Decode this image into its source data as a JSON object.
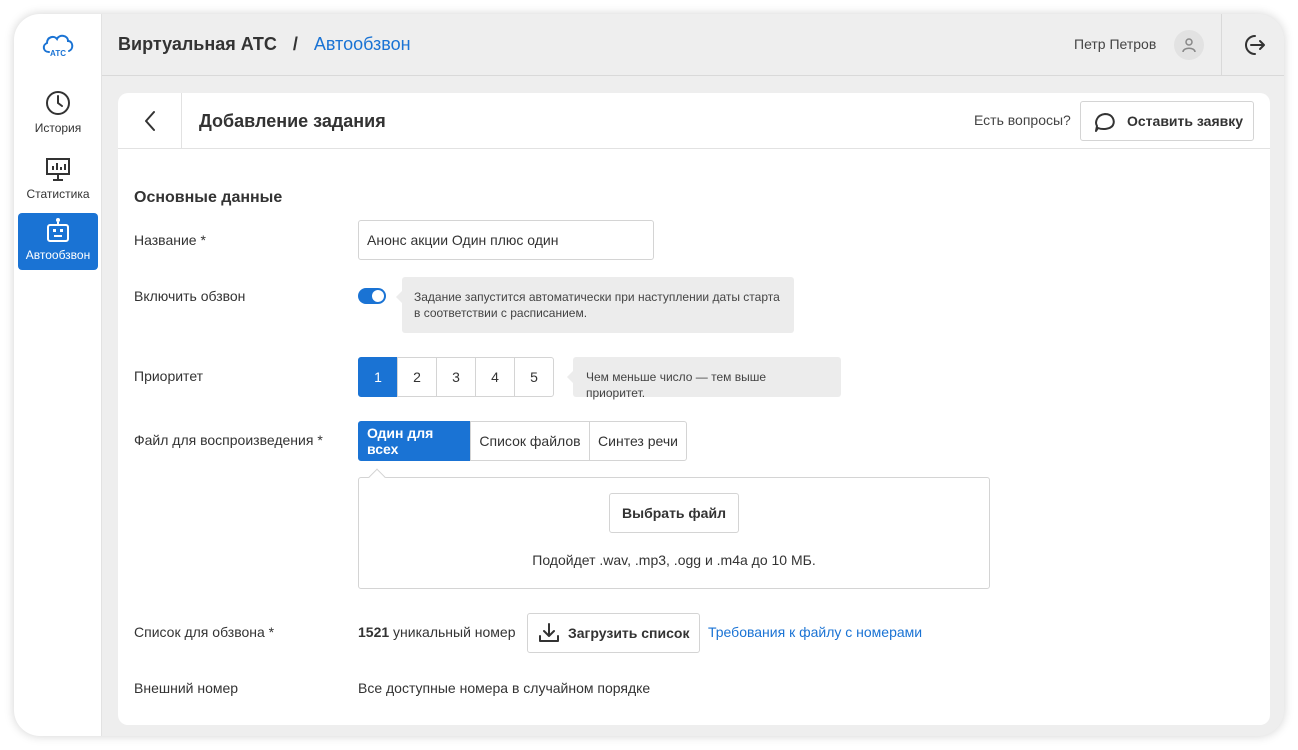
{
  "sidebar": {
    "logo_text": "АТС",
    "items": [
      {
        "label": "История",
        "icon": "clock-icon",
        "active": false
      },
      {
        "label": "Статистика",
        "icon": "chart-monitor-icon",
        "active": false
      },
      {
        "label": "Автообзвон",
        "icon": "robot-icon",
        "active": true
      }
    ]
  },
  "header": {
    "breadcrumb_root": "Виртуальная АТС",
    "breadcrumb_separator": "/",
    "breadcrumb_current": "Автообзвон",
    "user_name": "Петр Петров",
    "avatar_icon": "user-icon",
    "logout_icon": "logout-icon"
  },
  "card": {
    "back_icon": "chevron-left-icon",
    "title": "Добавление задания",
    "questions_text": "Есть вопросы?",
    "request_button": "Оставить заявку",
    "request_icon": "chat-bubble-icon"
  },
  "form": {
    "section_title": "Основные данные",
    "name": {
      "label": "Название *",
      "value": "Анонс акции Один плюс один"
    },
    "enable": {
      "label": "Включить обзвон",
      "on": true,
      "hint": "Задание запустится автоматически при наступлении даты старта в соответствии с расписанием."
    },
    "priority": {
      "label": "Приоритет",
      "options": [
        "1",
        "2",
        "3",
        "4",
        "5"
      ],
      "selected": "1",
      "hint": "Чем меньше число — тем выше приоритет."
    },
    "playback": {
      "label": "Файл для воспроизведения *",
      "tabs": [
        "Один для всех",
        "Список файлов",
        "Синтез речи"
      ],
      "selected": "Один для всех",
      "choose_button": "Выбрать файл",
      "note": "Подойдет .wav, .mp3, .ogg и .m4a до 10 МБ."
    },
    "call_list": {
      "label": "Список для обзвона *",
      "count": "1521",
      "count_suffix": " уникальный номер",
      "upload_button": "Загрузить список",
      "upload_icon": "download-icon",
      "requirements_link": "Требования к файлу с номерами"
    },
    "external_number": {
      "label": "Внешний номер",
      "value": "Все доступные номера в случайном порядке"
    }
  },
  "colors": {
    "accent": "#1a73d4",
    "background": "#eeeeee",
    "hint_background": "#ececec"
  }
}
